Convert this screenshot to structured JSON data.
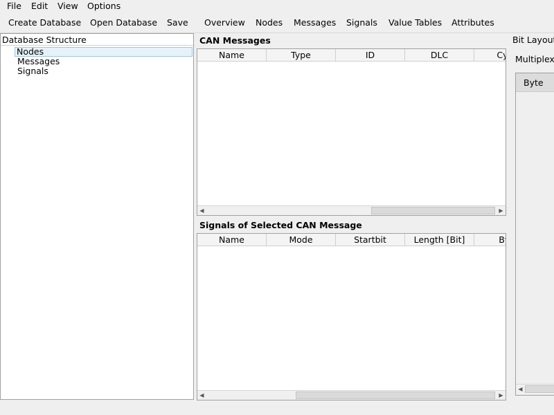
{
  "menu": [
    "File",
    "Edit",
    "View",
    "Options"
  ],
  "toolbar": [
    "Create Database",
    "Open Database",
    "Save",
    "Overview",
    "Nodes",
    "Messages",
    "Signals",
    "Value Tables",
    "Attributes"
  ],
  "tree": {
    "header": "Database Structure",
    "items": [
      "Nodes",
      "Messages",
      "Signals"
    ]
  },
  "can_messages": {
    "title": "CAN Messages",
    "columns": [
      "Name",
      "Type",
      "ID",
      "DLC",
      "Cycle"
    ]
  },
  "signals": {
    "title": "Signals of Selected CAN Message",
    "columns": [
      "Name",
      "Mode",
      "Startbit",
      "Length [Bit]",
      "Byte"
    ]
  },
  "bit_layout": {
    "title": "Bit Layout",
    "multiplexor_label": "Multiplexor",
    "byte_header": "Byte"
  },
  "icons": {
    "scroll_left": "arrow-left-icon",
    "scroll_right": "arrow-right-icon"
  }
}
